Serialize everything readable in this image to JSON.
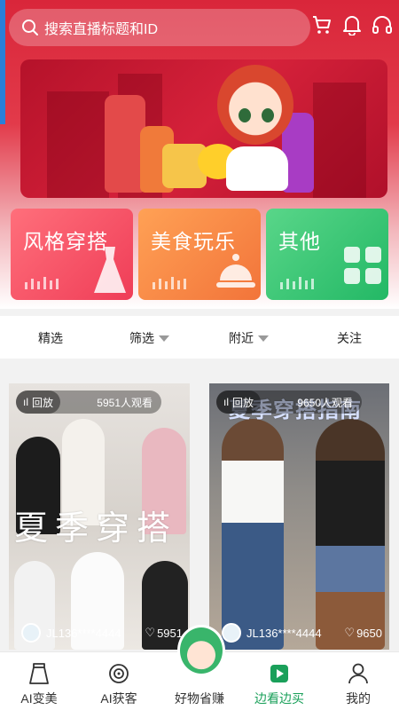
{
  "search": {
    "placeholder": "搜索直播标题和ID"
  },
  "header_icons": [
    "cart-icon",
    "bell-icon",
    "headset-icon"
  ],
  "categories": [
    {
      "label": "风格穿搭",
      "color": "#ef3d57"
    },
    {
      "label": "美食玩乐",
      "color": "#f2743a"
    },
    {
      "label": "其他",
      "color": "#23b865"
    }
  ],
  "filters": [
    {
      "label": "精选"
    },
    {
      "label": "筛选",
      "dropdown": true
    },
    {
      "label": "附近",
      "dropdown": true
    },
    {
      "label": "关注"
    }
  ],
  "cards": [
    {
      "badge": "回放",
      "viewers": "5951人观看",
      "overlay_title": "夏季穿搭",
      "user": "JL136****4444",
      "likes": "5951"
    },
    {
      "badge": "回放",
      "viewers": "9650人观看",
      "overlay_title": "夏季穿搭指南",
      "user": "JL136****4444",
      "likes": "9650"
    }
  ],
  "tabs": [
    {
      "label": "AI变美",
      "icon": "skirt-icon"
    },
    {
      "label": "AI获客",
      "icon": "target-icon"
    },
    {
      "label": "好物省赚",
      "icon": "mascot-icon"
    },
    {
      "label": "边看边买",
      "icon": "play-icon",
      "active": true
    },
    {
      "label": "我的",
      "icon": "person-icon"
    }
  ],
  "colors": {
    "accent": "#1aa05a",
    "header": "#d9263a"
  }
}
